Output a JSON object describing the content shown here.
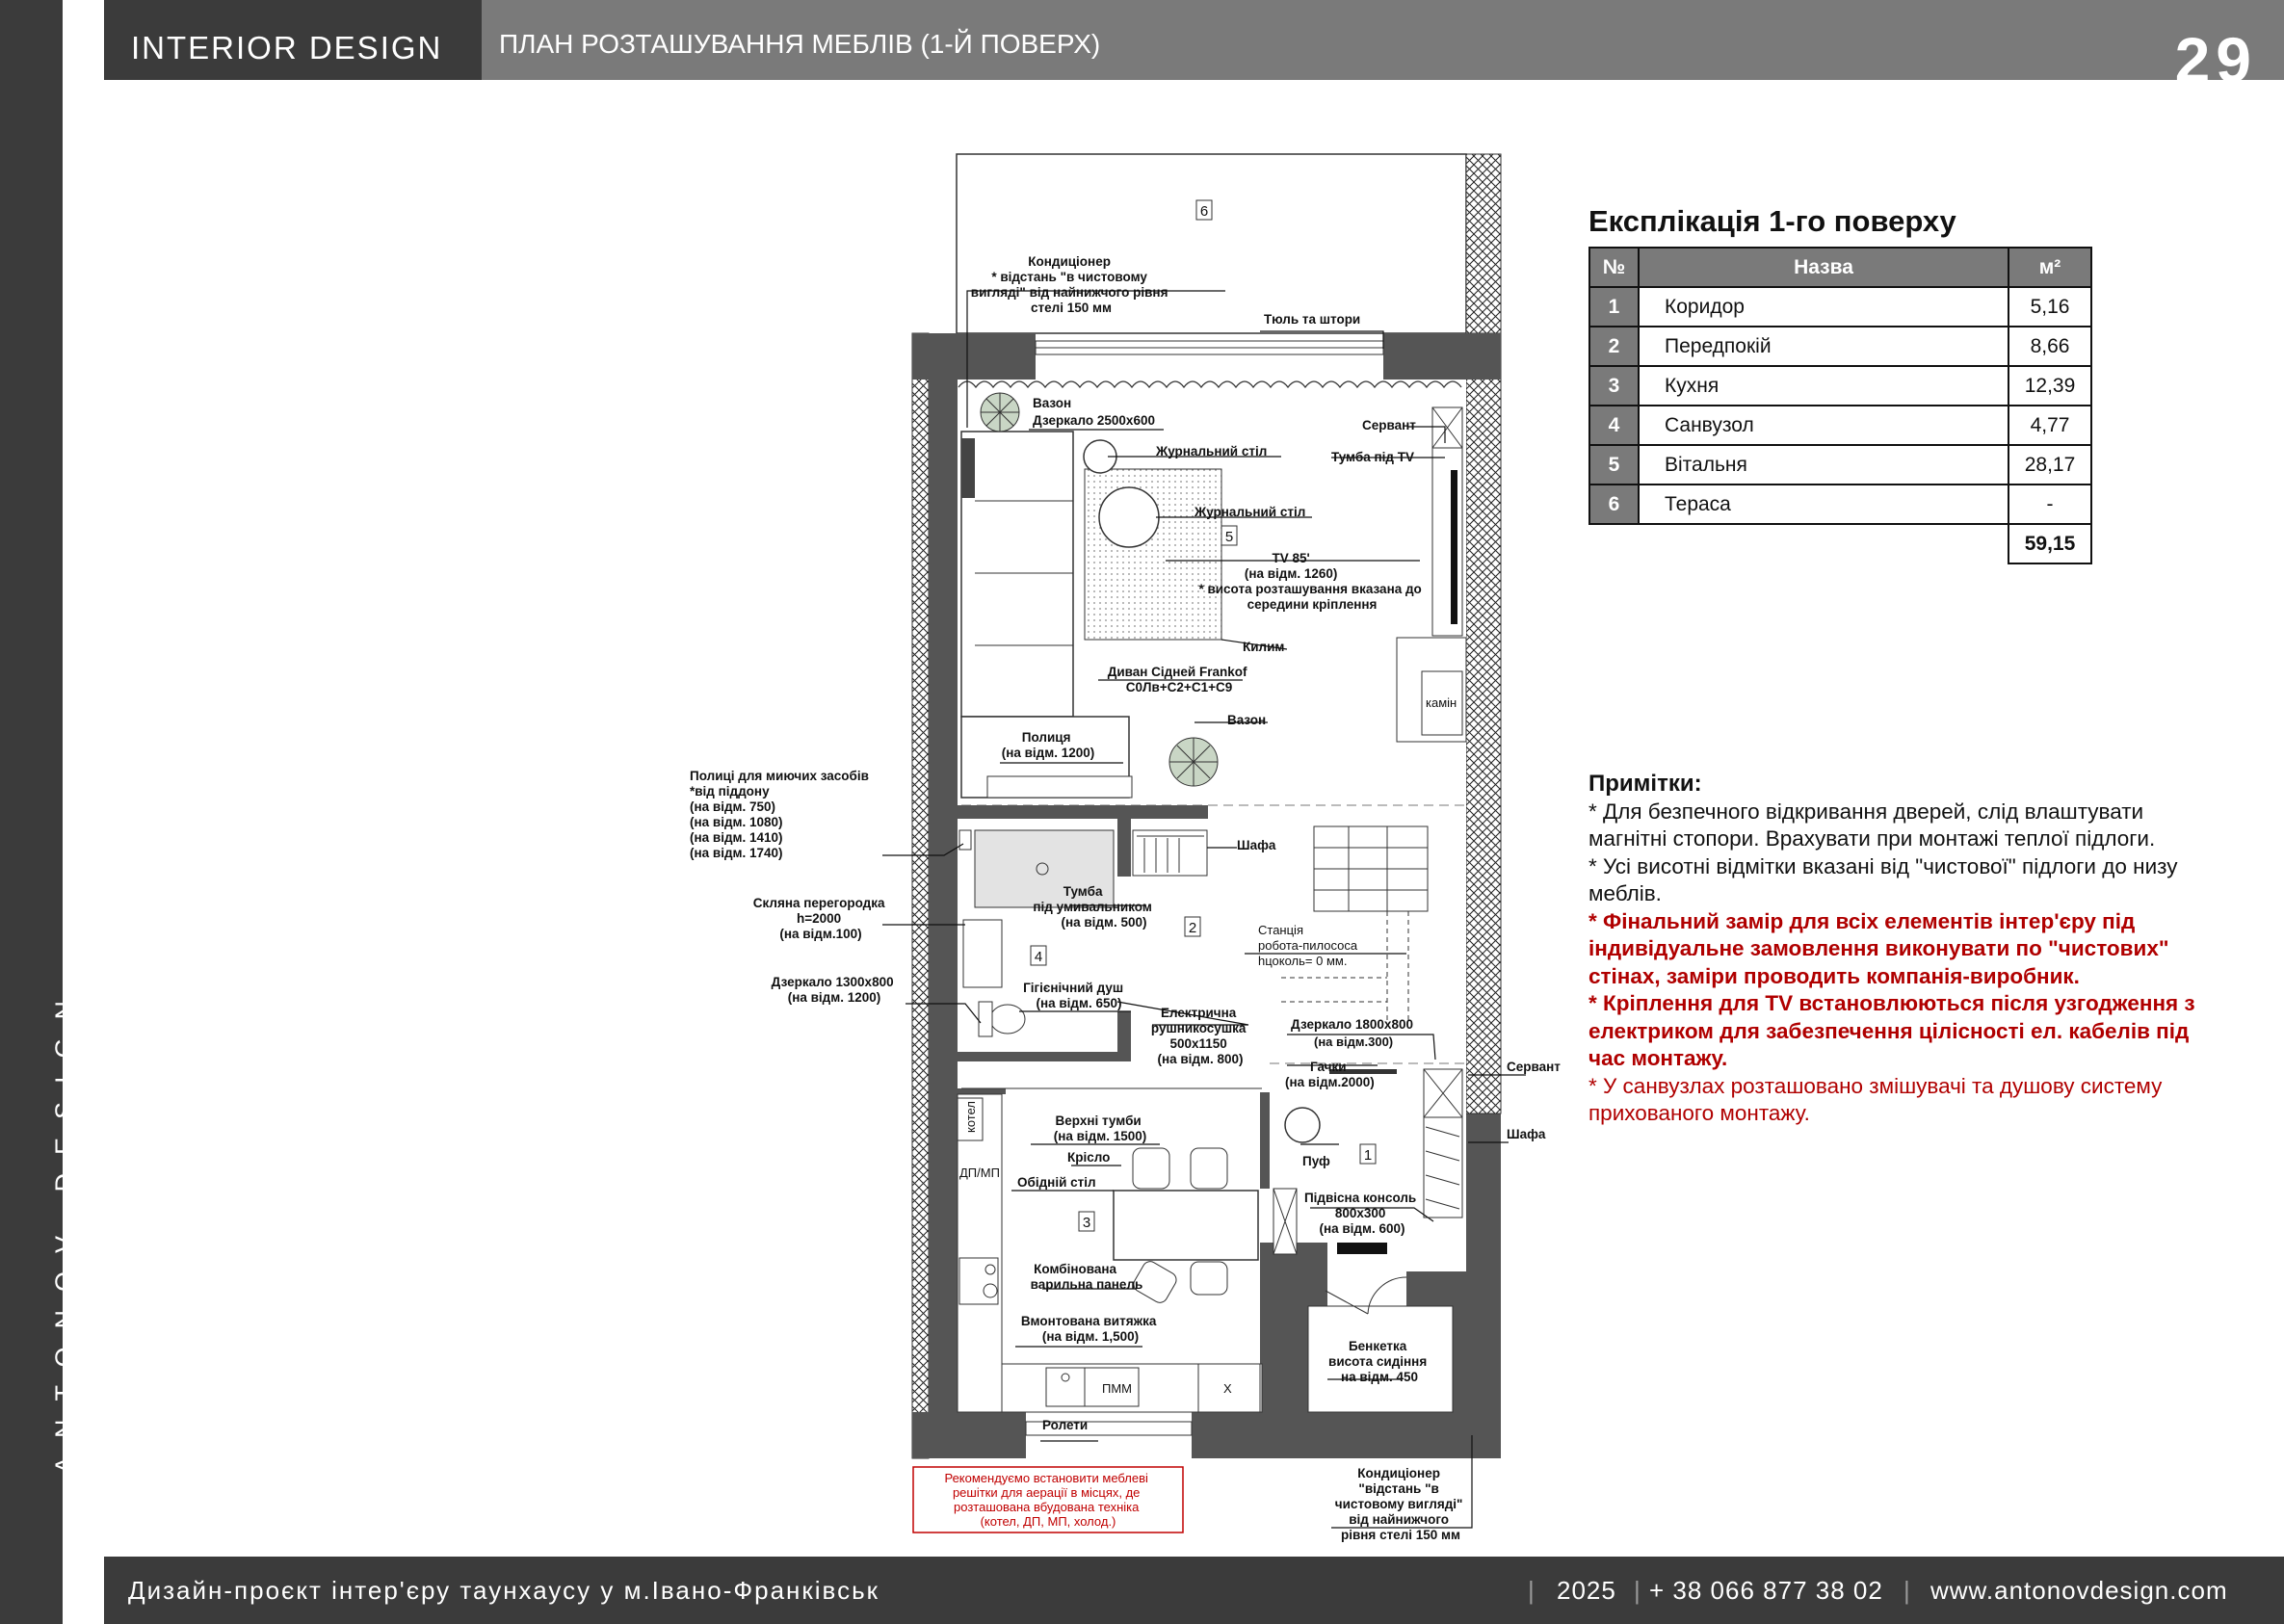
{
  "sidebar": {
    "brand": "ANTONOV DESIGN"
  },
  "header": {
    "brand": "INTERIOR DESIGN",
    "subtitle": "ПЛАН РОЗТАШУВАННЯ МЕБЛІВ (1-Й ПОВЕРХ)",
    "page_number": "29"
  },
  "plan": {
    "room_numbers": [
      "1",
      "2",
      "3",
      "4",
      "5",
      "6"
    ],
    "labels": {
      "ac_top": [
        "Кондиціонер",
        "* відстань \"в чистовому",
        "вигляді\" від найнижчого рівня",
        "стелі 150 мм"
      ],
      "tulle": "Тюль та штори",
      "vase1": "Вазон",
      "mirror_big": "Дзеркало 2500х600",
      "servant_top": "Сервант",
      "tv_stand": "Тумба під TV",
      "coffee1": "Журнальний стіл",
      "coffee2": "Журнальний стіл",
      "tv": [
        "TV 85'",
        "(на відм. 1260)",
        "* висота розташування вказана до",
        "середини кріплення"
      ],
      "rug": "Килим",
      "sofa": [
        "Диван Сідней Frankof",
        "С0Лв+С2+С1+С9"
      ],
      "vase2": "Вазон",
      "fireplace": "камін",
      "shelf": [
        "Полиця",
        "(на відм. 1200)"
      ],
      "shelves_wash": [
        "Полиці для миючих засобів",
        "*від піддону",
        "(на відм. 750)",
        "(на відм. 1080)",
        "(на відм. 1410)",
        "(на відм. 1740)"
      ],
      "wardrobe_mid": "Шафа",
      "sink_stand": [
        "Тумба",
        "під умивальником",
        "(на відм. 500)"
      ],
      "glass": [
        "Скляна перегородка",
        "h=2000",
        "(на відм.100)"
      ],
      "station": [
        "Станція",
        "робота-пилососа",
        "hцоколь= 0 мм."
      ],
      "hyg_shower": [
        "Гігієнічний душ",
        "(на відм. 650)"
      ],
      "mirror_bath": [
        "Дзеркало 1300х800",
        "(на відм. 1200)"
      ],
      "towel": [
        "Електрична",
        "рушникосушка",
        "500х1150",
        "(на відм. 800)"
      ],
      "mirror_hall": [
        "Дзеркало 1800х800",
        "(на відм.300)"
      ],
      "hooks": [
        "Гачки",
        "(на відм.2000)"
      ],
      "servant_low": "Сервант",
      "wardrobe_low": "Шафа",
      "boiler": "котел",
      "upper_cab": [
        "Верхні тумби",
        "(на відм. 1500)"
      ],
      "chair": "Крісло",
      "dining": "Обідній стіл",
      "dpmp": "ДП/МП",
      "pouf": "Пуф",
      "console": [
        "Підвісна консоль",
        "800х300",
        "(на відм. 600)"
      ],
      "hob": [
        "Комбінована",
        "варильна панель"
      ],
      "hood": [
        "Вмонтована витяжка",
        "(на відм. 1,500)"
      ],
      "bench": [
        "Бенкетка",
        "висота сидіння",
        "на відм. 450"
      ],
      "dishwasher": "ПММ",
      "x_mark": "Х",
      "blinds": "Ролети",
      "ac_bottom": [
        "Кондиціонер",
        "\"відстань \"в",
        "чистовому вигляді\"",
        "від найнижчого",
        "рівня стелі 150 мм"
      ],
      "recommend": [
        "Рекомендуємо встановити меблеві",
        "решітки для аерації в місцях, де",
        "розташована вбудована техніка",
        "(котел, ДП, МП, холод.)"
      ]
    }
  },
  "explication": {
    "title": "Експлікація 1-го поверху",
    "headers": {
      "no": "№",
      "name": "Назва",
      "area": "м²"
    },
    "rows": [
      {
        "no": "1",
        "name": "Коридор",
        "area": "5,16"
      },
      {
        "no": "2",
        "name": "Передпокій",
        "area": "8,66"
      },
      {
        "no": "3",
        "name": "Кухня",
        "area": "12,39"
      },
      {
        "no": "4",
        "name": "Санвузол",
        "area": "4,77"
      },
      {
        "no": "5",
        "name": "Вітальня",
        "area": "28,17"
      },
      {
        "no": "6",
        "name": "Тераса",
        "area": "-"
      }
    ],
    "total": "59,15"
  },
  "notes": {
    "title": "Примітки:",
    "n1": "* Для безпечного відкривання дверей, слід влаштувати магнітні стопори. Врахувати при монтажі теплої підлоги.",
    "n2": "* Усі висотні відмітки вказані від \"чистової\" підлоги до низу меблів.",
    "n3": "* Фінальний замір для всіх елементів інтер'єру під індивідуальне замовлення виконувати по \"чистових\" стінах, заміри проводить компанія-виробник.",
    "n4": "* Кріплення для TV встановлюються після узгодження з електриком для забезпечення цілісності ел. кабелів під час монтажу.",
    "n5": "* У санвузлах розташовано змішувачі та душову систему прихованого монтажу."
  },
  "footer": {
    "project": "Дизайн-проєкт інтер'єру таунхаусу у м.Івано-Франківськ",
    "year": "2025",
    "phone": "+ 38 066 877 38 02",
    "website": "www.antonovdesign.com"
  }
}
